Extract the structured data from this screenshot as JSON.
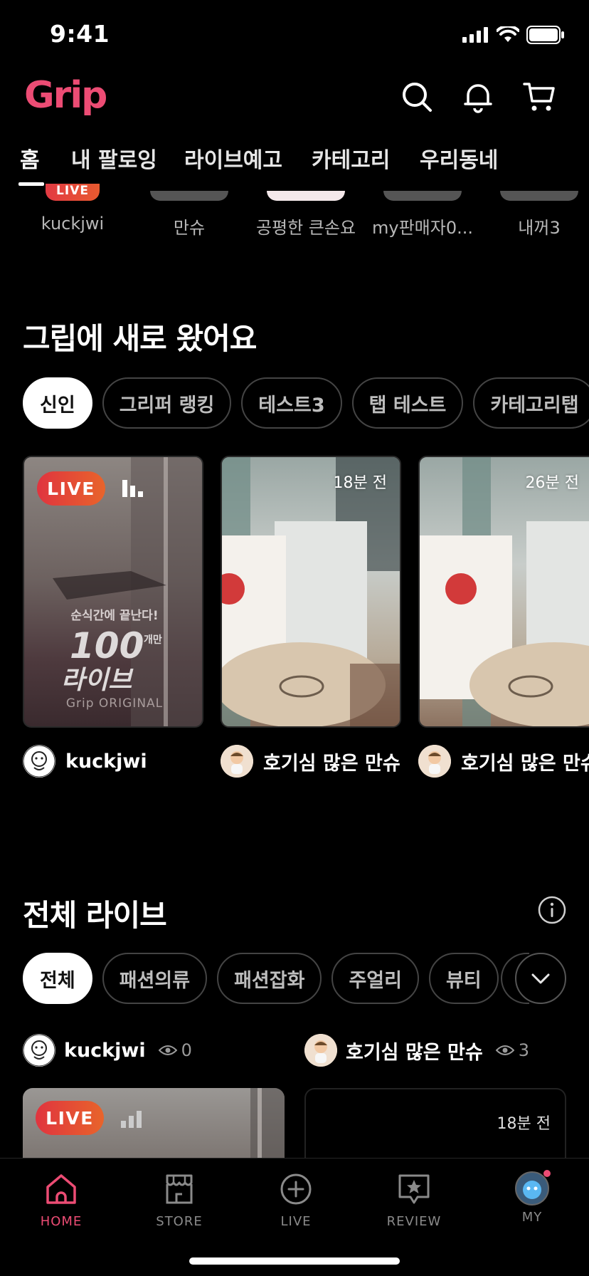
{
  "status_bar": {
    "time": "9:41"
  },
  "header": {
    "logo": "Grip"
  },
  "tabs": [
    {
      "label": "홈"
    },
    {
      "label": "내 팔로잉"
    },
    {
      "label": "라이브예고"
    },
    {
      "label": "카테고리"
    },
    {
      "label": "우리동네"
    }
  ],
  "stories": {
    "live_badge": "LIVE",
    "items": [
      {
        "name": "kuckjwi"
      },
      {
        "name": "만슈"
      },
      {
        "name": "공평한 큰손요"
      },
      {
        "name": "my판매자0..."
      },
      {
        "name": "내꺼3"
      }
    ]
  },
  "new_section": {
    "title": "그립에 새로 왔어요",
    "chips": [
      "신인",
      "그리퍼 랭킹",
      "테스트3",
      "탭 테스트",
      "카테고리탭"
    ],
    "cards": [
      {
        "badge": "LIVE",
        "seller": "kuckjwi",
        "overlay_line1": "순식간에 끝난다!",
        "overlay_big": "100",
        "overlay_small": "개만",
        "overlay_line2": "라이브",
        "overlay_brand": "Grip ORIGINAL"
      },
      {
        "time": "18분 전",
        "seller": "호기심 많은 만슈"
      },
      {
        "time": "26분 전",
        "seller": "호기심 많은 만슈"
      }
    ]
  },
  "all_live": {
    "title": "전체 라이브",
    "chips": [
      "전체",
      "패션의류",
      "패션잡화",
      "주얼리",
      "뷰티"
    ],
    "items": [
      {
        "seller": "kuckjwi",
        "views": "0",
        "badge": "LIVE"
      },
      {
        "seller": "호기심 많은 만슈",
        "views": "3",
        "time": "18분 전"
      }
    ]
  },
  "tabbar": [
    {
      "label": "HOME",
      "icon": "home-icon"
    },
    {
      "label": "STORE",
      "icon": "store-icon"
    },
    {
      "label": "LIVE",
      "icon": "plus-circle-icon"
    },
    {
      "label": "REVIEW",
      "icon": "review-icon"
    },
    {
      "label": "MY",
      "icon": "avatar"
    }
  ],
  "colors": {
    "brand": "#ec4c74",
    "live_start": "#e0343f",
    "live_end": "#e8642b"
  }
}
